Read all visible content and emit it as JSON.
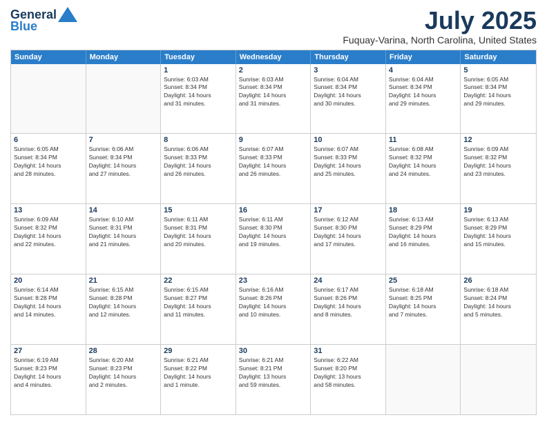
{
  "header": {
    "logo_line1": "General",
    "logo_line2": "Blue",
    "month_year": "July 2025",
    "location": "Fuquay-Varina, North Carolina, United States"
  },
  "days_of_week": [
    "Sunday",
    "Monday",
    "Tuesday",
    "Wednesday",
    "Thursday",
    "Friday",
    "Saturday"
  ],
  "weeks": [
    [
      {
        "day": "",
        "info": ""
      },
      {
        "day": "",
        "info": ""
      },
      {
        "day": "1",
        "info": "Sunrise: 6:03 AM\nSunset: 8:34 PM\nDaylight: 14 hours\nand 31 minutes."
      },
      {
        "day": "2",
        "info": "Sunrise: 6:03 AM\nSunset: 8:34 PM\nDaylight: 14 hours\nand 31 minutes."
      },
      {
        "day": "3",
        "info": "Sunrise: 6:04 AM\nSunset: 8:34 PM\nDaylight: 14 hours\nand 30 minutes."
      },
      {
        "day": "4",
        "info": "Sunrise: 6:04 AM\nSunset: 8:34 PM\nDaylight: 14 hours\nand 29 minutes."
      },
      {
        "day": "5",
        "info": "Sunrise: 6:05 AM\nSunset: 8:34 PM\nDaylight: 14 hours\nand 29 minutes."
      }
    ],
    [
      {
        "day": "6",
        "info": "Sunrise: 6:05 AM\nSunset: 8:34 PM\nDaylight: 14 hours\nand 28 minutes."
      },
      {
        "day": "7",
        "info": "Sunrise: 6:06 AM\nSunset: 8:34 PM\nDaylight: 14 hours\nand 27 minutes."
      },
      {
        "day": "8",
        "info": "Sunrise: 6:06 AM\nSunset: 8:33 PM\nDaylight: 14 hours\nand 26 minutes."
      },
      {
        "day": "9",
        "info": "Sunrise: 6:07 AM\nSunset: 8:33 PM\nDaylight: 14 hours\nand 26 minutes."
      },
      {
        "day": "10",
        "info": "Sunrise: 6:07 AM\nSunset: 8:33 PM\nDaylight: 14 hours\nand 25 minutes."
      },
      {
        "day": "11",
        "info": "Sunrise: 6:08 AM\nSunset: 8:32 PM\nDaylight: 14 hours\nand 24 minutes."
      },
      {
        "day": "12",
        "info": "Sunrise: 6:09 AM\nSunset: 8:32 PM\nDaylight: 14 hours\nand 23 minutes."
      }
    ],
    [
      {
        "day": "13",
        "info": "Sunrise: 6:09 AM\nSunset: 8:32 PM\nDaylight: 14 hours\nand 22 minutes."
      },
      {
        "day": "14",
        "info": "Sunrise: 6:10 AM\nSunset: 8:31 PM\nDaylight: 14 hours\nand 21 minutes."
      },
      {
        "day": "15",
        "info": "Sunrise: 6:11 AM\nSunset: 8:31 PM\nDaylight: 14 hours\nand 20 minutes."
      },
      {
        "day": "16",
        "info": "Sunrise: 6:11 AM\nSunset: 8:30 PM\nDaylight: 14 hours\nand 19 minutes."
      },
      {
        "day": "17",
        "info": "Sunrise: 6:12 AM\nSunset: 8:30 PM\nDaylight: 14 hours\nand 17 minutes."
      },
      {
        "day": "18",
        "info": "Sunrise: 6:13 AM\nSunset: 8:29 PM\nDaylight: 14 hours\nand 16 minutes."
      },
      {
        "day": "19",
        "info": "Sunrise: 6:13 AM\nSunset: 8:29 PM\nDaylight: 14 hours\nand 15 minutes."
      }
    ],
    [
      {
        "day": "20",
        "info": "Sunrise: 6:14 AM\nSunset: 8:28 PM\nDaylight: 14 hours\nand 14 minutes."
      },
      {
        "day": "21",
        "info": "Sunrise: 6:15 AM\nSunset: 8:28 PM\nDaylight: 14 hours\nand 12 minutes."
      },
      {
        "day": "22",
        "info": "Sunrise: 6:15 AM\nSunset: 8:27 PM\nDaylight: 14 hours\nand 11 minutes."
      },
      {
        "day": "23",
        "info": "Sunrise: 6:16 AM\nSunset: 8:26 PM\nDaylight: 14 hours\nand 10 minutes."
      },
      {
        "day": "24",
        "info": "Sunrise: 6:17 AM\nSunset: 8:26 PM\nDaylight: 14 hours\nand 8 minutes."
      },
      {
        "day": "25",
        "info": "Sunrise: 6:18 AM\nSunset: 8:25 PM\nDaylight: 14 hours\nand 7 minutes."
      },
      {
        "day": "26",
        "info": "Sunrise: 6:18 AM\nSunset: 8:24 PM\nDaylight: 14 hours\nand 5 minutes."
      }
    ],
    [
      {
        "day": "27",
        "info": "Sunrise: 6:19 AM\nSunset: 8:23 PM\nDaylight: 14 hours\nand 4 minutes."
      },
      {
        "day": "28",
        "info": "Sunrise: 6:20 AM\nSunset: 8:23 PM\nDaylight: 14 hours\nand 2 minutes."
      },
      {
        "day": "29",
        "info": "Sunrise: 6:21 AM\nSunset: 8:22 PM\nDaylight: 14 hours\nand 1 minute."
      },
      {
        "day": "30",
        "info": "Sunrise: 6:21 AM\nSunset: 8:21 PM\nDaylight: 13 hours\nand 59 minutes."
      },
      {
        "day": "31",
        "info": "Sunrise: 6:22 AM\nSunset: 8:20 PM\nDaylight: 13 hours\nand 58 minutes."
      },
      {
        "day": "",
        "info": ""
      },
      {
        "day": "",
        "info": ""
      }
    ]
  ]
}
